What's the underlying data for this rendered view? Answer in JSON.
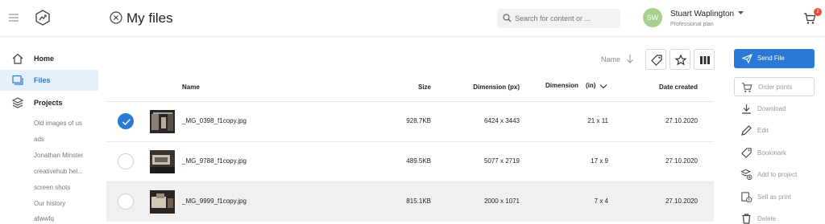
{
  "header": {
    "title": "My files",
    "search_placeholder": "Search for content or ...",
    "user": {
      "initials": "SW",
      "name": "Stuart Waplington",
      "plan": "Professional plan"
    },
    "cart_count": "2"
  },
  "sidebar": {
    "items": [
      {
        "label": "Home"
      },
      {
        "label": "Files"
      },
      {
        "label": "Projects"
      }
    ],
    "projects": [
      "Old images of us",
      "ads",
      "Jonathan Minster",
      "creativehub hel...",
      "screen shots",
      "Our history",
      "afwwfq"
    ]
  },
  "toolbar": {
    "sort_label": "Name"
  },
  "table": {
    "columns": {
      "name": "Name",
      "size": "Size",
      "dimension_px": "Dimension (px)",
      "dimension": "Dimension",
      "dimension_unit": "(in)",
      "date": "Date created"
    },
    "rows": [
      {
        "name": "_MG_0398_f1copy.jpg",
        "size": "928.7KB",
        "dim_px": "6424 x 3443",
        "dim_in": "21 x 11",
        "date": "27.10.2020",
        "selected": true
      },
      {
        "name": "_MG_9788_f1copy.jpg",
        "size": "489.5KB",
        "dim_px": "5077 x 2719",
        "dim_in": "17 x 9",
        "date": "27.10.2020",
        "selected": false
      },
      {
        "name": "_MG_9999_f1copy.jpg",
        "size": "815.1KB",
        "dim_px": "2000 x 1071",
        "dim_in": "7 x 4",
        "date": "27.10.2020",
        "selected": false
      }
    ]
  },
  "actions": {
    "send": "Send File",
    "order": "Order prints",
    "items": [
      "Download",
      "Edit",
      "Bookmark",
      "Add to project",
      "Sell as print",
      "Delete"
    ]
  },
  "colors": {
    "accent": "#2b79d6",
    "avatar": "#a8d08d",
    "badge": "#e74c3c",
    "active_bg": "#e6f0fb"
  }
}
